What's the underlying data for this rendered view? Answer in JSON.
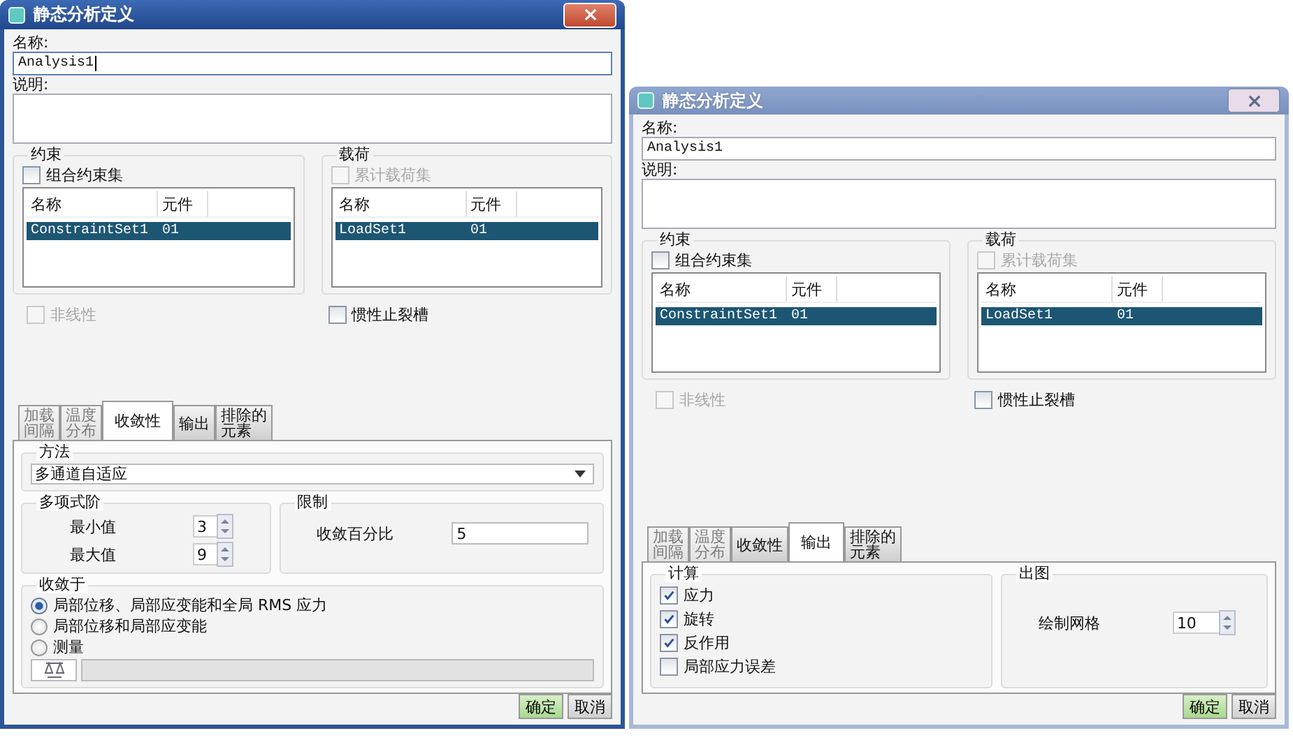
{
  "windows": [
    {
      "title": "静态分析定义",
      "active": true,
      "name_label": "名称:",
      "name_value": "Analysis1",
      "name_focused": true,
      "description_label": "说明:",
      "groups": [
        {
          "title": "约束",
          "checkbox": {
            "label": "组合约束集",
            "checked": false,
            "disabled": false
          },
          "columns": [
            "名称",
            "元件"
          ],
          "rows": [
            {
              "cells": [
                "ConstraintSet1",
                "01"
              ],
              "selected": true
            }
          ]
        },
        {
          "title": "载荷",
          "checkbox": {
            "label": "累计载荷集",
            "checked": false,
            "disabled": true
          },
          "columns": [
            "名称",
            "元件"
          ],
          "rows": [
            {
              "cells": [
                "LoadSet1",
                "01"
              ],
              "selected": true
            }
          ]
        }
      ],
      "options": [
        {
          "label": "非线性",
          "checked": false,
          "disabled": true
        },
        {
          "label": "惯性止裂槽",
          "checked": false,
          "disabled": false
        }
      ],
      "tabs": [
        {
          "label": "加载间隔",
          "kind": "stacked",
          "selected": false,
          "disabled": true
        },
        {
          "label": "温度分布",
          "kind": "stacked",
          "selected": false,
          "disabled": true
        },
        {
          "label": "收敛性",
          "kind": "single",
          "selected": true,
          "disabled": false
        },
        {
          "label": "输出",
          "kind": "single",
          "selected": false,
          "disabled": false
        },
        {
          "label": "排除的元素",
          "kind": "stacked",
          "selected": false,
          "disabled": false
        }
      ],
      "panel": {
        "kind": "convergence",
        "method": {
          "title": "方法",
          "value": "多通道自适应"
        },
        "order": {
          "title": "多项式阶",
          "fields": [
            {
              "label": "最小值",
              "value": "3"
            },
            {
              "label": "最大值",
              "value": "9"
            }
          ]
        },
        "limits": {
          "title": "限制",
          "label": "收敛百分比",
          "value": "5"
        },
        "converge": {
          "title": "收敛于",
          "options": [
            {
              "label": "局部位移、局部应变能和全局 RMS 应力",
              "selected": true
            },
            {
              "label": "局部位移和局部应变能",
              "selected": false
            },
            {
              "label": "测量",
              "selected": false
            }
          ],
          "measure_field": {
            "disabled": true
          }
        }
      },
      "buttons": [
        {
          "label": "确定",
          "kind": "primary"
        },
        {
          "label": "取消",
          "kind": "normal"
        }
      ]
    },
    {
      "title": "静态分析定义",
      "active": false,
      "name_label": "名称:",
      "name_value": "Analysis1",
      "name_focused": false,
      "description_label": "说明:",
      "groups": [
        {
          "title": "约束",
          "checkbox": {
            "label": "组合约束集",
            "checked": false,
            "disabled": false
          },
          "columns": [
            "名称",
            "元件"
          ],
          "rows": [
            {
              "cells": [
                "ConstraintSet1",
                "01"
              ],
              "selected": true
            }
          ]
        },
        {
          "title": "载荷",
          "checkbox": {
            "label": "累计载荷集",
            "checked": false,
            "disabled": true
          },
          "columns": [
            "名称",
            "元件"
          ],
          "rows": [
            {
              "cells": [
                "LoadSet1",
                "01"
              ],
              "selected": true
            }
          ]
        }
      ],
      "options": [
        {
          "label": "非线性",
          "checked": false,
          "disabled": true
        },
        {
          "label": "惯性止裂槽",
          "checked": false,
          "disabled": false
        }
      ],
      "tabs": [
        {
          "label": "加载间隔",
          "kind": "stacked",
          "selected": false,
          "disabled": true
        },
        {
          "label": "温度分布",
          "kind": "stacked",
          "selected": false,
          "disabled": true
        },
        {
          "label": "收敛性",
          "kind": "single",
          "selected": false,
          "disabled": false
        },
        {
          "label": "输出",
          "kind": "single",
          "selected": true,
          "disabled": false
        },
        {
          "label": "排除的元素",
          "kind": "stacked",
          "selected": false,
          "disabled": false
        }
      ],
      "panel": {
        "kind": "output",
        "calculate": {
          "title": "计算",
          "items": [
            {
              "label": "应力",
              "checked": true
            },
            {
              "label": "旋转",
              "checked": true
            },
            {
              "label": "反作用",
              "checked": true
            },
            {
              "label": "局部应力误差",
              "checked": false
            }
          ]
        },
        "plot": {
          "title": "出图",
          "label": "绘制网格",
          "value": "10"
        }
      },
      "buttons": [
        {
          "label": "确定",
          "kind": "primary"
        },
        {
          "label": "取消",
          "kind": "normal"
        }
      ]
    }
  ]
}
